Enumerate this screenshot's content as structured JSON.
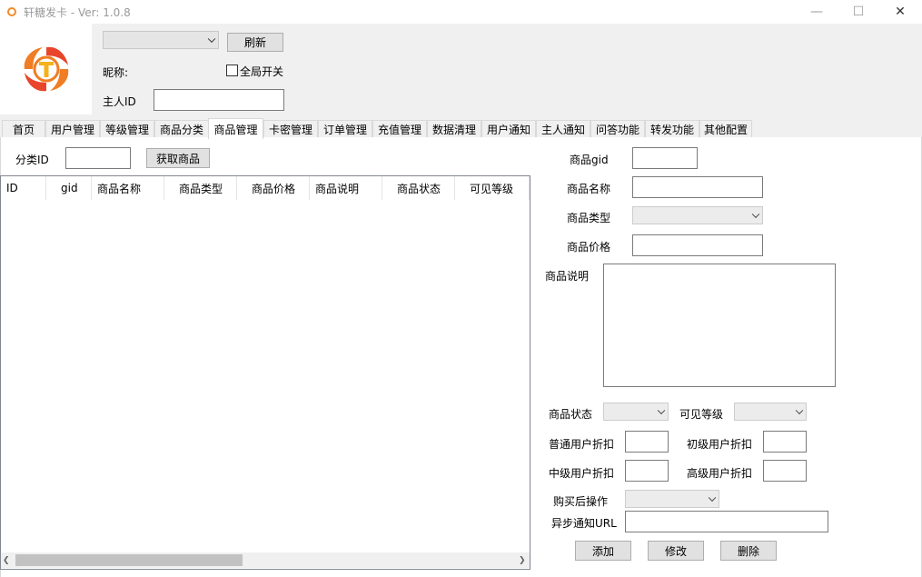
{
  "window": {
    "title": "轩糖发卡 - Ver: 1.0.8",
    "minimize": "—",
    "maximize": "☐",
    "close": "✕"
  },
  "header": {
    "account_select_value": "",
    "refresh_button": "刷新",
    "nickname_label": "昵称:",
    "global_switch_label": "全局开关",
    "global_switch_checked": false,
    "owner_id_label": "主人ID",
    "owner_id_value": ""
  },
  "tabs": [
    {
      "label": "首页"
    },
    {
      "label": "用户管理"
    },
    {
      "label": "等级管理"
    },
    {
      "label": "商品分类"
    },
    {
      "label": "商品管理"
    },
    {
      "label": "卡密管理"
    },
    {
      "label": "订单管理"
    },
    {
      "label": "充值管理"
    },
    {
      "label": "数据清理"
    },
    {
      "label": "用户通知"
    },
    {
      "label": "主人通知"
    },
    {
      "label": "问答功能"
    },
    {
      "label": "转发功能"
    },
    {
      "label": "其他配置"
    }
  ],
  "active_tab": "商品管理",
  "filter": {
    "category_id_label": "分类ID",
    "category_id_value": "",
    "get_products_button": "获取商品"
  },
  "table": {
    "columns": [
      "ID",
      "gid",
      "商品名称",
      "商品类型",
      "商品价格",
      "商品说明",
      "商品状态",
      "可见等级"
    ],
    "rows": []
  },
  "form": {
    "gid_label": "商品gid",
    "name_label": "商品名称",
    "type_label": "商品类型",
    "price_label": "商品价格",
    "desc_label": "商品说明",
    "status_label": "商品状态",
    "visible_level_label": "可见等级",
    "normal_discount_label": "普通用户折扣",
    "junior_discount_label": "初级用户折扣",
    "middle_discount_label": "中级用户折扣",
    "senior_discount_label": "高级用户折扣",
    "after_purchase_label": "购买后操作",
    "async_url_label": "异步通知URL",
    "add_button": "添加",
    "edit_button": "修改",
    "delete_button": "删除"
  },
  "colors": {
    "logo_orange": "#f07d23",
    "logo_red": "#e8452c",
    "logo_yellow": "#f6b21a"
  }
}
